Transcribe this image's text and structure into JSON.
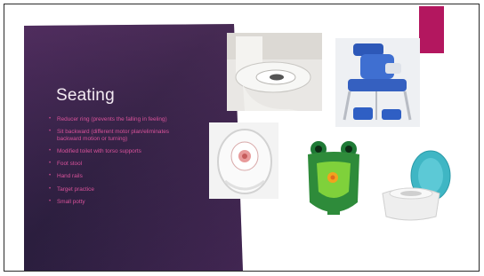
{
  "slide": {
    "title": "Seating",
    "bullets": [
      "Reducer ring (prevents the falling in feeling)",
      "Sit backward (different motor plan/eliminates backward motion or turning)",
      "Modified toilet with torso supports",
      "Foot stool",
      "Hand rails",
      "Target practice",
      "Small potty"
    ]
  },
  "colors": {
    "panel_dark": "#2b1f3f",
    "panel_purple": "#4a2a5a",
    "accent": "#b3175f",
    "bullet_text": "#d9529a",
    "title_text": "#f3eaf2"
  },
  "images": [
    {
      "name": "toilet-with-reducer-ring-photo",
      "icon": "toilet-seat"
    },
    {
      "name": "supportive-toilet-seat-photo",
      "icon": "support-chair"
    },
    {
      "name": "reducer-ring-topdown-photo",
      "icon": "toilet-bowl-top"
    },
    {
      "name": "frog-urinal-photo",
      "icon": "frog-urinal"
    },
    {
      "name": "small-potty-photo",
      "icon": "potty-chair"
    }
  ]
}
